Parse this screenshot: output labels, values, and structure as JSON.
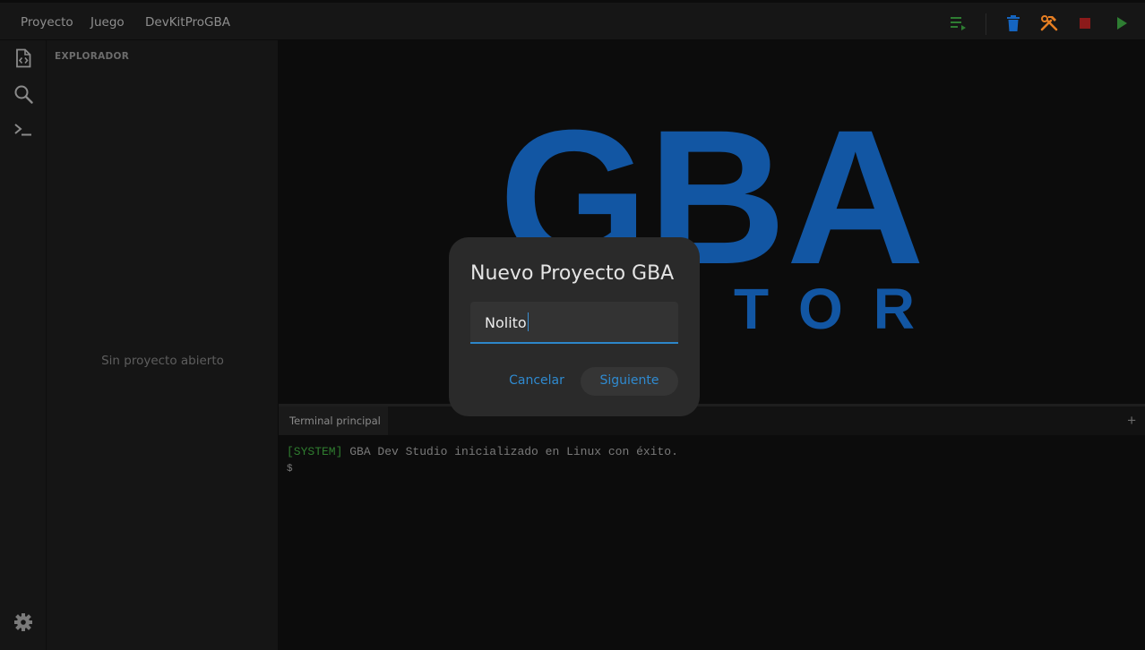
{
  "menu": {
    "items": [
      "Proyecto",
      "Juego",
      "DevKitProGBA"
    ]
  },
  "toolbar": {
    "icons": [
      "build-list-icon",
      "trash-icon",
      "tools-icon",
      "stop-icon",
      "play-icon"
    ],
    "colors": {
      "build_list": "#2e7d32",
      "trash": "#1565c0",
      "tools": "#e67e22",
      "stop": "#8b1a1a",
      "play": "#2e7d32"
    }
  },
  "activity_bar": {
    "icons": [
      "file-code-icon",
      "search-icon",
      "terminal-icon",
      "gear-icon"
    ]
  },
  "sidebar": {
    "title": "EXPLORADOR",
    "empty_message": "Sin proyecto abierto"
  },
  "editor": {
    "splash_logo_text": "GBA",
    "splash_logo_subtext": "TOR",
    "logo_color": "#1256a3"
  },
  "terminal": {
    "tab_label": "Terminal principal",
    "add_label": "+",
    "system_tag": "[SYSTEM]",
    "system_message": " GBA Dev Studio inicializado en Linux con éxito.",
    "prompt": "$"
  },
  "dialog": {
    "title": "Nuevo Proyecto GBA",
    "input_value": "Nolito",
    "cancel_label": "Cancelar",
    "next_label": "Siguiente",
    "accent_color": "#2d86c9"
  }
}
